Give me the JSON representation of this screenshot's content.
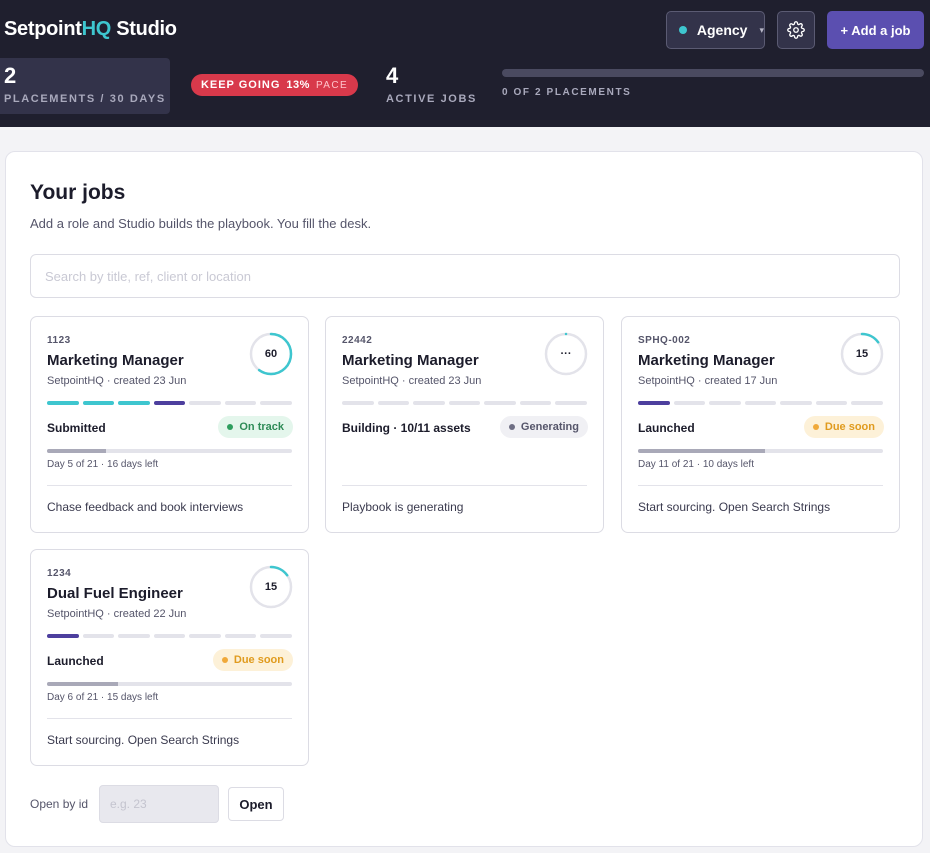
{
  "header": {
    "brand_main": "Setpoint",
    "brand_accent": "HQ",
    "brand_suffix": " Studio",
    "agency_label": "Agency",
    "add_job_label": "+ Add a job",
    "placements_count": "2",
    "placements_label": "PLACEMENTS / 30 DAYS",
    "pace_status": "KEEP GOING",
    "pace_percent": "13%",
    "pace_label": "PACE",
    "active_jobs_count": "4",
    "active_jobs_label": "ACTIVE JOBS",
    "placements_progress_label": "0 OF 2 PLACEMENTS",
    "placements_progress": 0
  },
  "colors": {
    "accent_teal": "#3ec6cf",
    "brand_purple": "#5b4fb0",
    "pace_red": "#d8394b",
    "header_bg": "#1f1f2e"
  },
  "main": {
    "title": "Your jobs",
    "subtitle": "Add a role and Studio builds the playbook. You fill the desk.",
    "search_placeholder": "Search by title, ref, client or location",
    "open_by_id_label": "Open by id",
    "open_by_id_placeholder": "e.g. 23",
    "open_button": "Open"
  },
  "jobs": [
    {
      "ref": "1123",
      "title": "Marketing Manager",
      "meta": "SetpointHQ · created 23 Jun",
      "score": "60",
      "score_fraction": 0.6,
      "stages": [
        "teal",
        "teal",
        "teal",
        "purple",
        "empty",
        "empty",
        "empty"
      ],
      "stage_label": "Submitted",
      "status": "On track",
      "status_color": "green",
      "day_progress": 0.24,
      "days_text": "Day 5 of 21 · 16 days left",
      "next_step": "Chase feedback and book interviews"
    },
    {
      "ref": "22442",
      "title": "Marketing Manager",
      "meta": "SetpointHQ · created 23 Jun",
      "score": "···",
      "score_fraction": 0,
      "stages": [
        "empty",
        "empty",
        "empty",
        "empty",
        "empty",
        "empty",
        "empty"
      ],
      "stage_label": "Building · 10/11 assets",
      "status": "Generating",
      "status_color": "grey",
      "day_progress": null,
      "days_text": "",
      "next_step": "Playbook is generating"
    },
    {
      "ref": "SPHQ-002",
      "title": "Marketing Manager",
      "meta": "SetpointHQ · created 17 Jun",
      "score": "15",
      "score_fraction": 0.15,
      "stages": [
        "purple",
        "empty",
        "empty",
        "empty",
        "empty",
        "empty",
        "empty"
      ],
      "stage_label": "Launched",
      "status": "Due soon",
      "status_color": "amber",
      "day_progress": 0.52,
      "days_text": "Day 11 of 21 · 10 days left",
      "next_step": "Start sourcing. Open Search Strings"
    },
    {
      "ref": "1234",
      "title": "Dual Fuel Engineer",
      "meta": "SetpointHQ · created 22 Jun",
      "score": "15",
      "score_fraction": 0.15,
      "stages": [
        "purple",
        "empty",
        "empty",
        "empty",
        "empty",
        "empty",
        "empty"
      ],
      "stage_label": "Launched",
      "status": "Due soon",
      "status_color": "amber",
      "day_progress": 0.29,
      "days_text": "Day 6 of 21 · 15 days left",
      "next_step": "Start sourcing. Open Search Strings"
    }
  ]
}
